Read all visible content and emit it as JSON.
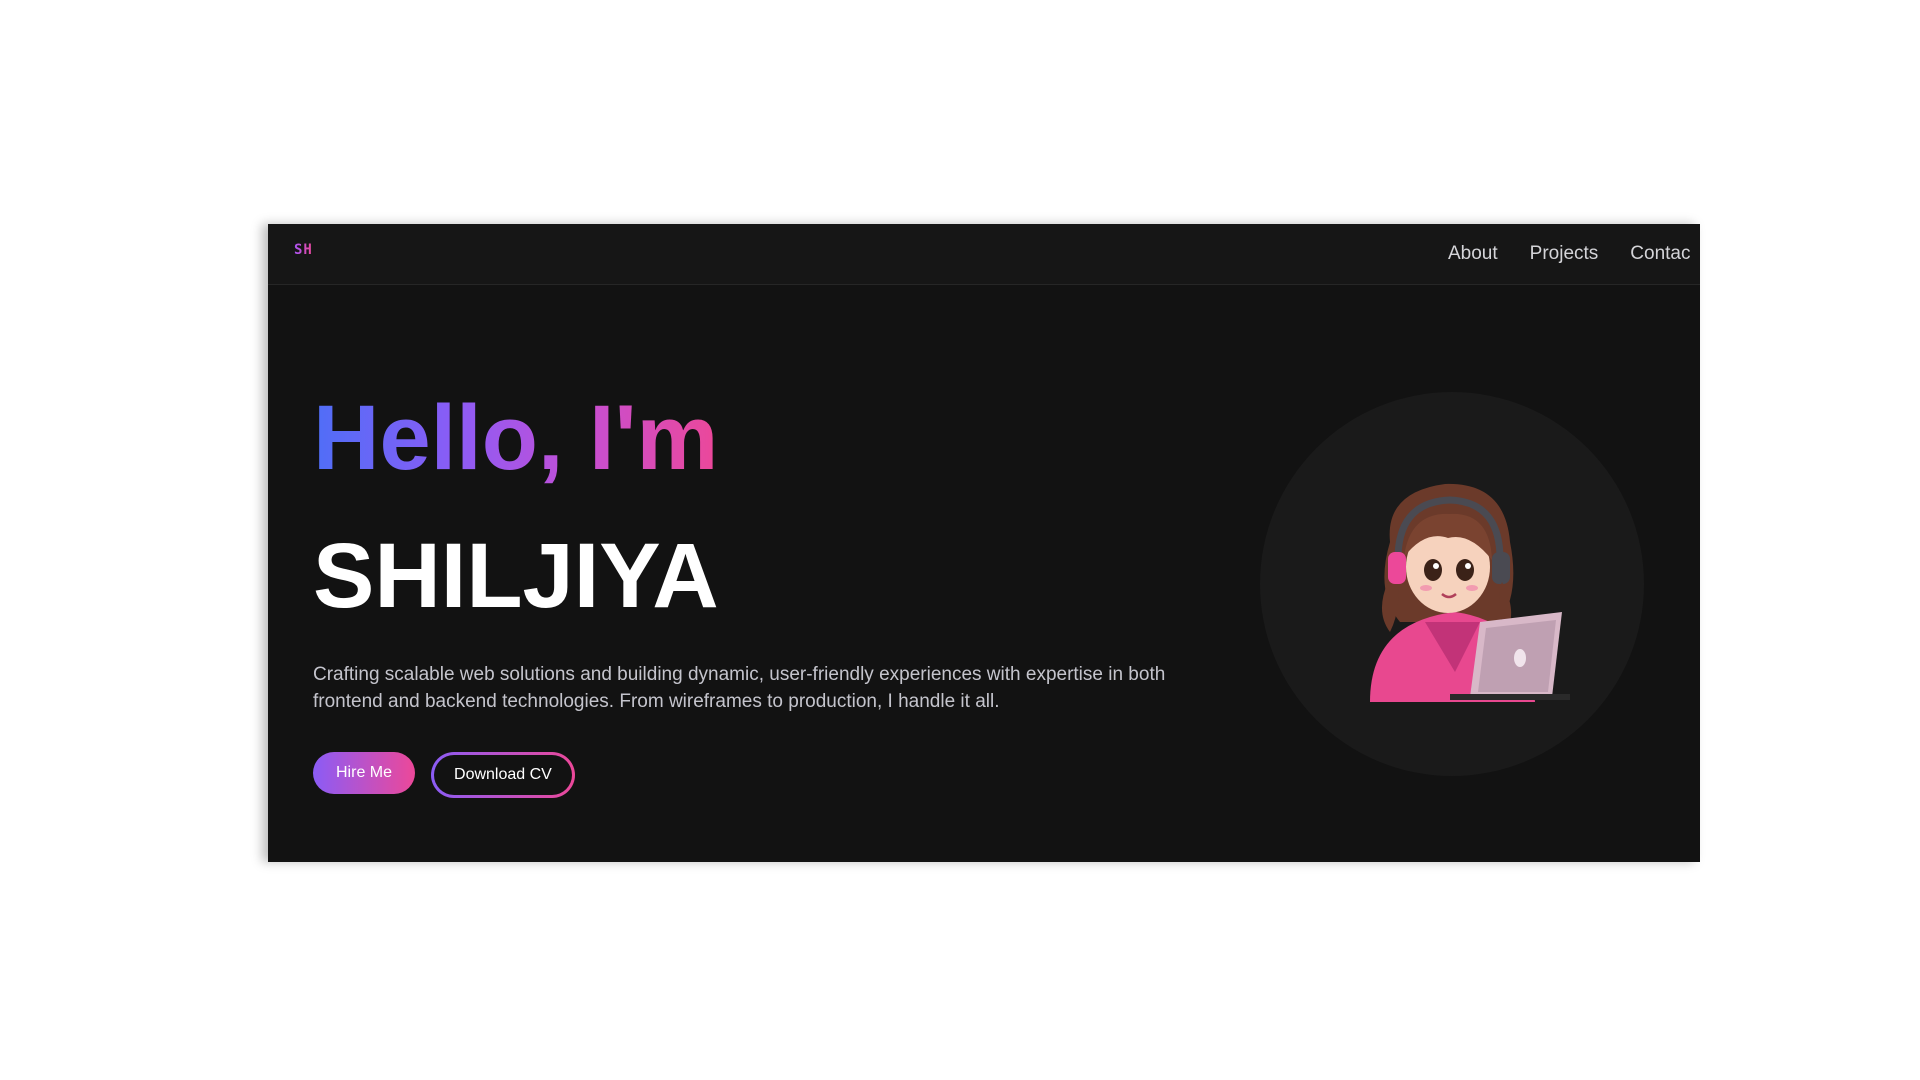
{
  "header": {
    "logo": "SH",
    "nav": [
      {
        "label": "About"
      },
      {
        "label": "Projects"
      },
      {
        "label": "Contac"
      }
    ]
  },
  "hero": {
    "greeting": "Hello, I'm",
    "name": "SHILJIYA",
    "description": "Crafting scalable web solutions and building dynamic, user-friendly experiences with expertise in both frontend and backend technologies. From wireframes to production, I handle it all.",
    "primary_button": "Hire Me",
    "secondary_button": "Download CV"
  },
  "colors": {
    "background": "#121212",
    "accent_start": "#8b5cf6",
    "accent_end": "#ec4899",
    "greeting_blue": "#4f6ef7"
  },
  "icons": {
    "avatar": "girl-with-headphones-laptop-illustration"
  }
}
